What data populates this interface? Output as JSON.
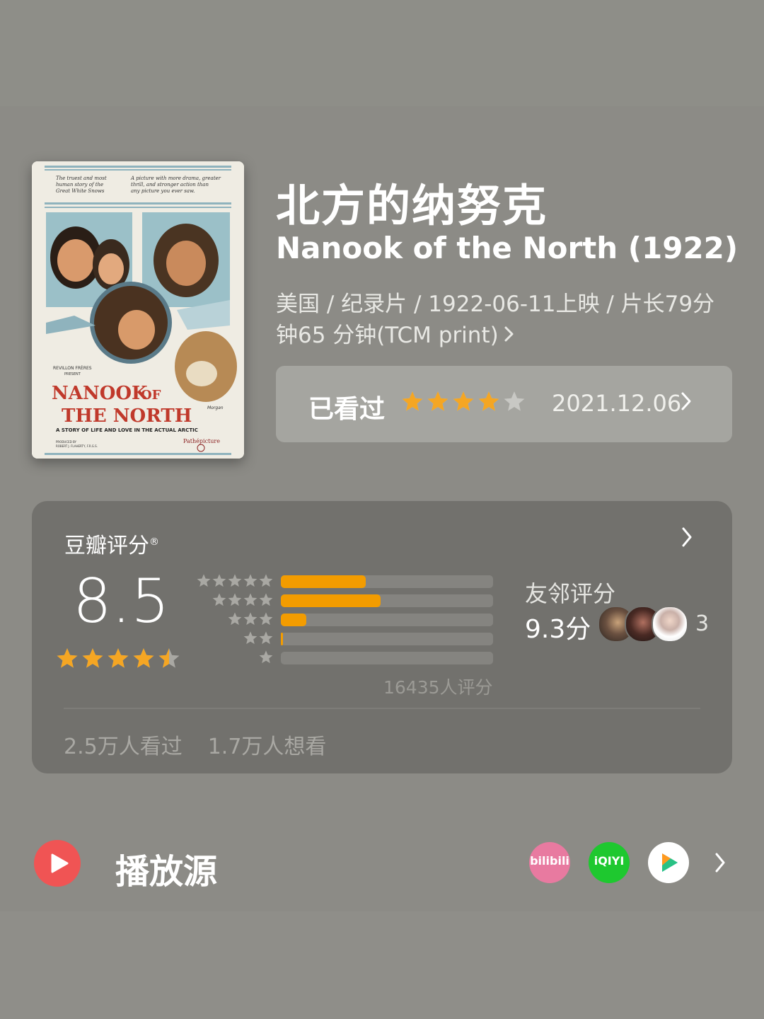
{
  "movie": {
    "title_cn": "北方的纳努克",
    "title_en": "Nanook of the North (1922)",
    "meta": "美国 / 纪录片 / 1922-06-11上映 / 片长79分钟65 分钟(TCM print)",
    "meta_chevron": "chevron-right-icon"
  },
  "poster": {
    "top_left": "The truest and most human story of the Great White Snows",
    "top_right": "A picture with more drama, greater thrill, and stronger action than any picture you ever saw.",
    "presenter": "REVILLON FRÈRES PRESENT",
    "title_line1": "NANOOK OF",
    "title_line2": "THE NORTH",
    "tagline": "A STORY OF LIFE AND LOVE IN THE ACTUAL ARCTIC",
    "credit": "PRODUCED BY ROBERT J. FLAHERTY, F.R.G.S.",
    "distributor": "Pathépicture",
    "artist": "Morgan"
  },
  "watched": {
    "label": "已看过",
    "my_rating": 4,
    "date": "2021.12.06"
  },
  "rating": {
    "source": "豆瓣评分",
    "registered": "®",
    "score": "8.5",
    "score_stars": 4.5,
    "distribution": [
      {
        "stars": 5,
        "fraction": 0.4
      },
      {
        "stars": 4,
        "fraction": 0.47
      },
      {
        "stars": 3,
        "fraction": 0.12
      },
      {
        "stars": 2,
        "fraction": 0.01
      },
      {
        "stars": 1,
        "fraction": 0.0
      }
    ],
    "count": "16435人评分",
    "friends_label": "友邻评分",
    "friends_score": "9.3分",
    "friends_count": "3",
    "watched_count": "2.5万人看过",
    "want_count": "1.7万人想看"
  },
  "play": {
    "title": "播放源",
    "providers": [
      {
        "name": "bilibili",
        "color": "#e87aa0"
      },
      {
        "name": "iQIYI",
        "color": "#1ec82f"
      },
      {
        "name": "Tencent Video",
        "color": "#ffffff"
      }
    ]
  },
  "colors": {
    "accent_star": "#f5a623",
    "bar_fill": "#f39c00",
    "play_red": "#f05454"
  }
}
